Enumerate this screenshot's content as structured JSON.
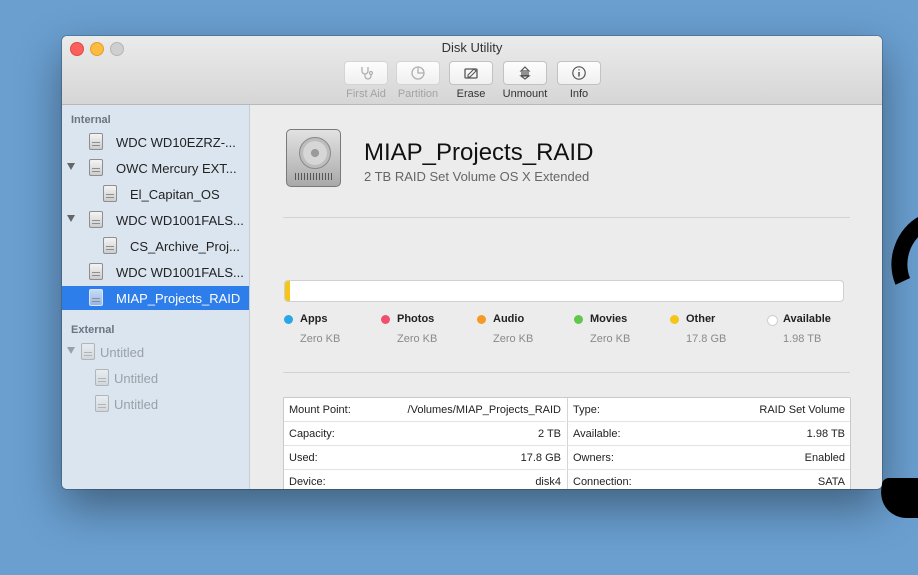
{
  "window": {
    "title": "Disk Utility"
  },
  "toolbar": [
    {
      "label": "First Aid",
      "icon": "stethoscope-icon",
      "enabled": false
    },
    {
      "label": "Partition",
      "icon": "pie-partition-icon",
      "enabled": false
    },
    {
      "label": "Erase",
      "icon": "erase-disk-icon",
      "enabled": true
    },
    {
      "label": "Unmount",
      "icon": "unmount-icon",
      "enabled": true
    },
    {
      "label": "Info",
      "icon": "info-icon",
      "enabled": true
    }
  ],
  "sidebar": {
    "internal_header": "Internal",
    "external_header": "External",
    "items": [
      {
        "label": "WDC WD10EZRZ-..."
      },
      {
        "label": "OWC Mercury EXT..."
      },
      {
        "label": "El_Capitan_OS"
      },
      {
        "label": "WDC WD1001FALS..."
      },
      {
        "label": "CS_Archive_Proj..."
      },
      {
        "label": "WDC WD1001FALS..."
      },
      {
        "label": "MIAP_Projects_RAID",
        "selected": true
      },
      {
        "label": "Untitled"
      },
      {
        "label": "Untitled"
      },
      {
        "label": "Untitled"
      }
    ]
  },
  "volume": {
    "name": "MIAP_Projects_RAID",
    "description": "2 TB RAID Set Volume OS X Extended",
    "icon": "hard-disk-icon"
  },
  "usage": {
    "used_fraction": 0.009,
    "fill_color": "#f5c518",
    "legend": [
      {
        "name": "Apps",
        "value": "Zero KB",
        "color": "#2aa7e6"
      },
      {
        "name": "Photos",
        "value": "Zero KB",
        "color": "#f0506e"
      },
      {
        "name": "Audio",
        "value": "Zero KB",
        "color": "#f59a23"
      },
      {
        "name": "Movies",
        "value": "Zero KB",
        "color": "#5fc84a"
      },
      {
        "name": "Other",
        "value": "17.8 GB",
        "color": "#f5c518"
      },
      {
        "name": "Available",
        "value": "1.98 TB",
        "color": "#ffffff"
      }
    ]
  },
  "info": {
    "left": [
      {
        "key": "Mount Point:",
        "value": "/Volumes/MIAP_Projects_RAID"
      },
      {
        "key": "Capacity:",
        "value": "2 TB"
      },
      {
        "key": "Used:",
        "value": "17.8 GB"
      },
      {
        "key": "Device:",
        "value": "disk4"
      }
    ],
    "right": [
      {
        "key": "Type:",
        "value": "RAID Set Volume"
      },
      {
        "key": "Available:",
        "value": "1.98 TB"
      },
      {
        "key": "Owners:",
        "value": "Enabled"
      },
      {
        "key": "Connection:",
        "value": "SATA"
      }
    ]
  }
}
